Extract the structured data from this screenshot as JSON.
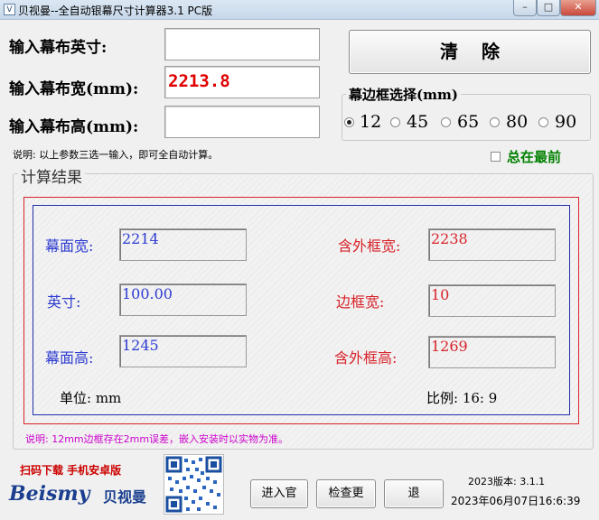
{
  "window": {
    "title": "贝视曼--全自动银幕尺寸计算器3.1 PC版",
    "icon": "app-icon"
  },
  "inputs": {
    "inch_label": "输入幕布英寸:",
    "width_label": "输入幕布宽(mm):",
    "height_label": "输入幕布高(mm):",
    "inch_value": "",
    "width_value": "2213.8",
    "height_value": ""
  },
  "clear_button": "清除",
  "frame_group": {
    "legend": "幕边框选择(mm)",
    "options": [
      "12",
      "45",
      "65",
      "80",
      "90"
    ],
    "selected": "12"
  },
  "hint": "说明: 以上参数三选一输入，即可全自动计算。",
  "always_on_top": {
    "label": "总在最前",
    "checked": false,
    "color": "#008000"
  },
  "results": {
    "legend": "计算结果",
    "screen_width_label": "幕面宽:",
    "screen_width_value": "2214",
    "outer_width_label": "含外框宽:",
    "outer_width_value": "2238",
    "inch_label": "英寸:",
    "inch_value": "100.00",
    "border_width_label": "边框宽:",
    "border_width_value": "10",
    "screen_height_label": "幕面高:",
    "screen_height_value": "1245",
    "outer_height_label": "含外框高:",
    "outer_height_value": "1269",
    "unit_label": "单位: mm",
    "ratio_label": "比例: 16: 9",
    "note": "说明: 12mm边框存在2mm误差，嵌入安装时以实物为准。"
  },
  "footer": {
    "scan_text": "扫码下载  手机安卓版",
    "logo_text": "Beismy",
    "logo_cn": "贝视曼",
    "buttons": [
      "进入官",
      "检查更",
      "退"
    ],
    "version": "2023版本: 3.1.1",
    "datetime": "2023年06月07日16:6:39"
  },
  "colors": {
    "blue": "#2d3bd1",
    "red": "#d8232a",
    "frame_outer": "#d8232a",
    "frame_inner": "#1f2fa8",
    "note": "#cc00cc",
    "scan_text": "#cc0000",
    "logo": "#1a3f8f"
  }
}
